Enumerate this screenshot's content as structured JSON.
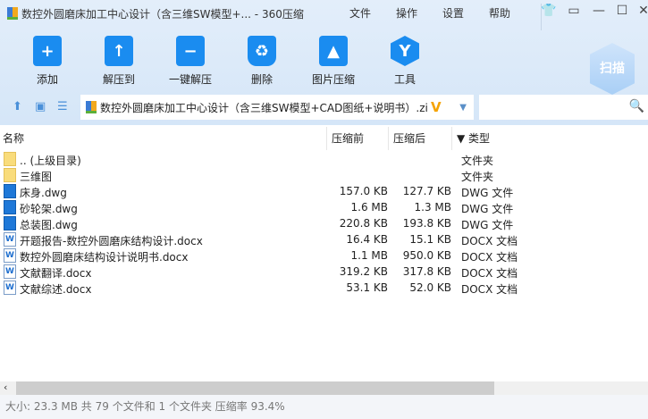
{
  "window": {
    "title": "数控外圆磨床加工中心设计（含三维SW模型+... - 360压缩",
    "menu": [
      "文件",
      "操作",
      "设置",
      "帮助"
    ]
  },
  "toolbar": {
    "buttons": [
      {
        "label": "添加",
        "icon": "add-icon"
      },
      {
        "label": "解压到",
        "icon": "extract-to-icon"
      },
      {
        "label": "一键解压",
        "icon": "one-click-extract-icon"
      },
      {
        "label": "删除",
        "icon": "delete-icon"
      },
      {
        "label": "图片压缩",
        "icon": "image-compress-icon"
      },
      {
        "label": "工具",
        "icon": "tools-icon"
      }
    ],
    "scan_label": "扫描"
  },
  "address": {
    "path": "数控外圆磨床加工中心设计（含三维SW模型+CAD图纸+说明书）.zip",
    "search_placeholder": ""
  },
  "columns": {
    "name": "名称",
    "before": "压缩前",
    "after": "压缩后",
    "type": "▼ 类型"
  },
  "files": [
    {
      "name": ".. (上级目录)",
      "before": "",
      "after": "",
      "type": "文件夹",
      "icon": "folder"
    },
    {
      "name": "三维图",
      "before": "",
      "after": "",
      "type": "文件夹",
      "icon": "folder"
    },
    {
      "name": "床身.dwg",
      "before": "157.0 KB",
      "after": "127.7 KB",
      "type": "DWG 文件",
      "icon": "dwg"
    },
    {
      "name": "砂轮架.dwg",
      "before": "1.6 MB",
      "after": "1.3 MB",
      "type": "DWG 文件",
      "icon": "dwg"
    },
    {
      "name": "总装图.dwg",
      "before": "220.8 KB",
      "after": "193.8 KB",
      "type": "DWG 文件",
      "icon": "dwg"
    },
    {
      "name": "开题报告-数控外圆磨床结构设计.docx",
      "before": "16.4 KB",
      "after": "15.1 KB",
      "type": "DOCX 文档",
      "icon": "doc"
    },
    {
      "name": "数控外圆磨床结构设计说明书.docx",
      "before": "1.1 MB",
      "after": "950.0 KB",
      "type": "DOCX 文档",
      "icon": "doc"
    },
    {
      "name": "文献翻译.docx",
      "before": "319.2 KB",
      "after": "317.8 KB",
      "type": "DOCX 文档",
      "icon": "doc"
    },
    {
      "name": "文献综述.docx",
      "before": "53.1 KB",
      "after": "52.0 KB",
      "type": "DOCX 文档",
      "icon": "doc"
    }
  ],
  "status": "大小: 23.3 MB 共 79 个文件和 1 个文件夹 压缩率 93.4%"
}
